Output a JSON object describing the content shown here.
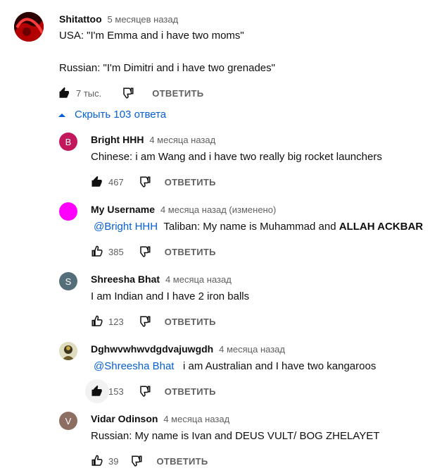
{
  "top_comment": {
    "author": "Shitattoo",
    "time": "5 месяцев назад",
    "line1": "USA: \"I'm Emma and i have two moms\"",
    "line2": "Russian: \"I'm Dimitri and i have two grenades\"",
    "likes": "7 тыс.",
    "reply_label": "ОТВЕТИТЬ"
  },
  "replies_toggle": {
    "label": "Скрыть 103 ответа"
  },
  "replies": [
    {
      "author": "Bright HHH",
      "time": "4 месяца назад",
      "avatar_letter": "B",
      "avatar_color": "#c2185b",
      "text": "Chinese: i am Wang and i have two really big rocket launchers",
      "likes": "467",
      "reply_label": "ОТВЕТИТЬ"
    },
    {
      "author": "My Username",
      "time": "4 месяца назад (изменено)",
      "avatar_letter": "",
      "avatar_color": "#ff00ff",
      "mention": "@Bright HHH",
      "text": "Taliban: My name is Muhammad and ",
      "text_bold": "ALLAH ACKBAR",
      "likes": "385",
      "reply_label": "ОТВЕТИТЬ"
    },
    {
      "author": "Shreesha Bhat",
      "time": "4 месяца назад",
      "avatar_letter": "S",
      "avatar_color": "#546e7a",
      "text": "I am Indian and I have 2 iron balls",
      "likes": "123",
      "reply_label": "ОТВЕТИТЬ"
    },
    {
      "author": "Dghwvwhwvdgdvajuwgdh",
      "time": "4 месяца назад",
      "avatar_letter": "",
      "avatar_color": "#8d7a3a",
      "mention": "@Shreesha Bhat",
      "text": "i am Australian and I have two kangaroos",
      "likes": "153",
      "reply_label": "ОТВЕТИТЬ"
    },
    {
      "author": "Vidar Odinson",
      "time": "4 месяца назад",
      "avatar_letter": "V",
      "avatar_color": "#8d6e63",
      "text": "Russian: My name is Ivan and DEUS VULT/ BOG ZHELAYET",
      "likes": "39",
      "reply_label": "ОТВЕТИТЬ"
    }
  ],
  "colors": {
    "link": "#065fd4",
    "secondary": "#606060",
    "text": "#0f0f0f"
  },
  "icons": {
    "like": "thumb-up-icon",
    "dislike": "thumb-down-icon",
    "toggle": "caret-up-icon"
  }
}
